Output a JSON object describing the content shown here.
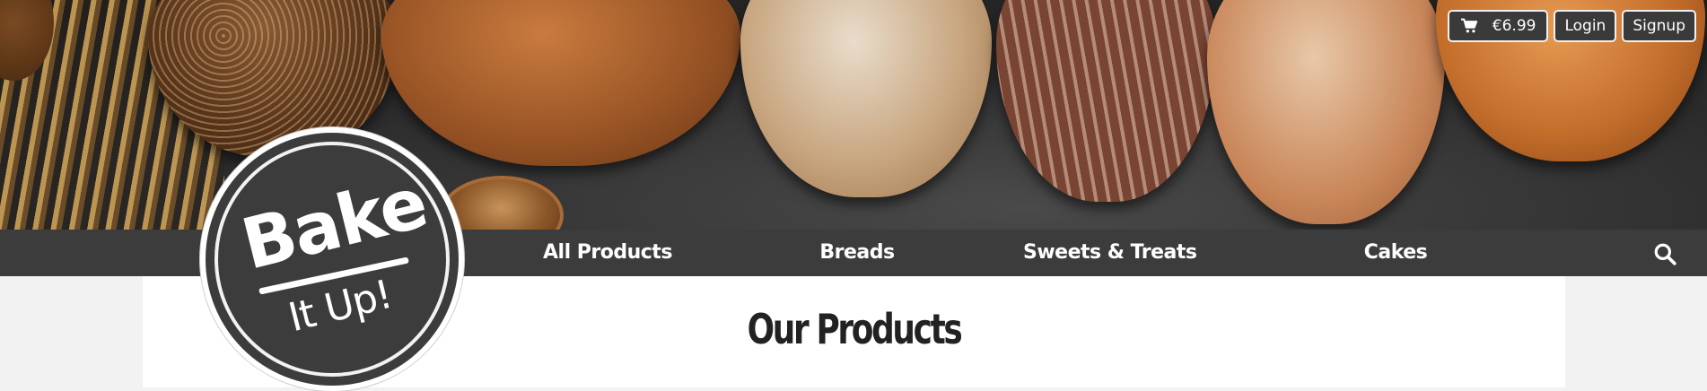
{
  "header": {
    "cart_total": "€6.99",
    "login_label": "Login",
    "signup_label": "Signup"
  },
  "nav": {
    "items": [
      {
        "label": "All Products"
      },
      {
        "label": "Breads"
      },
      {
        "label": "Sweets & Treats"
      },
      {
        "label": "Cakes"
      }
    ]
  },
  "logo": {
    "line1": "Bake",
    "line2": "It Up!"
  },
  "main": {
    "title": "Our Products"
  },
  "icons": {
    "cart": "cart-icon",
    "search": "search-icon"
  },
  "colors": {
    "nav_background": "#3c3c3c",
    "button_background": "#3a3a3a",
    "content_background": "#ffffff",
    "page_background": "#f2f2f2"
  }
}
